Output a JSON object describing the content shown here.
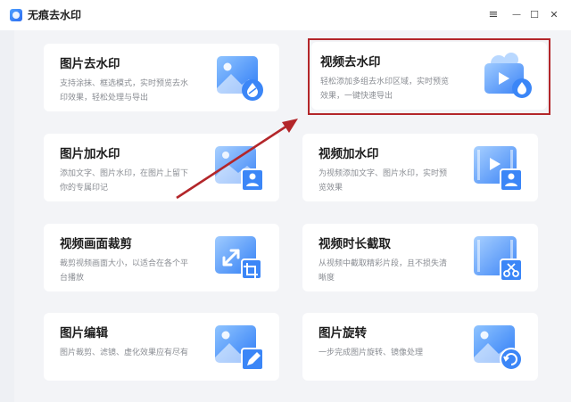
{
  "app": {
    "title": "无痕去水印"
  },
  "window_controls": {
    "menu": "≡",
    "minimize": "—",
    "maximize": "☐",
    "close": "✕"
  },
  "cards": [
    {
      "title": "图片去水印",
      "desc": "支持涂抹、框选模式，实时预览去水印效果，轻松处理与导出",
      "icon": "image-remove-watermark-icon"
    },
    {
      "title": "视频去水印",
      "desc": "轻松添加多组去水印区域，实时预览效果，一键快速导出",
      "icon": "video-remove-watermark-icon"
    },
    {
      "title": "图片加水印",
      "desc": "添加文字、图片水印，在图片上留下你的专属印记",
      "icon": "image-add-watermark-icon"
    },
    {
      "title": "视频加水印",
      "desc": "为视频添加文字、图片水印，实时预览效果",
      "icon": "video-add-watermark-icon"
    },
    {
      "title": "视频画面裁剪",
      "desc": "裁剪视频画面大小，以适合在各个平台播放",
      "icon": "video-crop-icon"
    },
    {
      "title": "视频时长截取",
      "desc": "从视频中截取精彩片段，且不损失清晰度",
      "icon": "video-trim-icon"
    },
    {
      "title": "图片编辑",
      "desc": "图片裁剪、滤镜、虚化效果应有尽有",
      "icon": "image-edit-icon"
    },
    {
      "title": "图片旋转",
      "desc": "一步完成图片旋转、镜像处理",
      "icon": "image-rotate-icon"
    }
  ],
  "colors": {
    "accent": "#3d8bff",
    "highlight": "#b3262a",
    "background": "#f3f4f7"
  }
}
